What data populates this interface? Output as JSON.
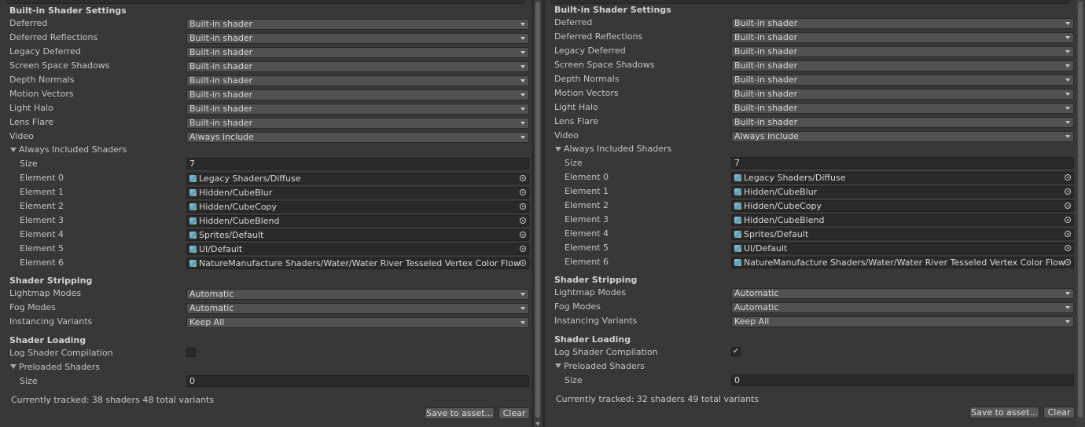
{
  "left": {
    "builtin_header": "Built-in Shader Settings",
    "builtin": [
      {
        "label": "Deferred",
        "value": "Built-in shader"
      },
      {
        "label": "Deferred Reflections",
        "value": "Built-in shader"
      },
      {
        "label": "Legacy Deferred",
        "value": "Built-in shader"
      },
      {
        "label": "Screen Space Shadows",
        "value": "Built-in shader"
      },
      {
        "label": "Depth Normals",
        "value": "Built-in shader"
      },
      {
        "label": "Motion Vectors",
        "value": "Built-in shader"
      },
      {
        "label": "Light Halo",
        "value": "Built-in shader"
      },
      {
        "label": "Lens Flare",
        "value": "Built-in shader"
      },
      {
        "label": "Video",
        "value": "Always include"
      }
    ],
    "always_label": "Always Included Shaders",
    "size_label": "Size",
    "size_value": "7",
    "elements": [
      {
        "label": "Element 0",
        "value": "Legacy Shaders/Diffuse"
      },
      {
        "label": "Element 1",
        "value": "Hidden/CubeBlur"
      },
      {
        "label": "Element 2",
        "value": "Hidden/CubeCopy"
      },
      {
        "label": "Element 3",
        "value": "Hidden/CubeBlend"
      },
      {
        "label": "Element 4",
        "value": "Sprites/Default"
      },
      {
        "label": "Element 5",
        "value": "UI/Default"
      },
      {
        "label": "Element 6",
        "value": "NatureManufacture Shaders/Water/Water River Tesseled Vertex Color Flow"
      }
    ],
    "stripping_header": "Shader Stripping",
    "stripping": [
      {
        "label": "Lightmap Modes",
        "value": "Automatic"
      },
      {
        "label": "Fog Modes",
        "value": "Automatic"
      },
      {
        "label": "Instancing Variants",
        "value": "Keep All"
      }
    ],
    "loading_header": "Shader Loading",
    "log_label": "Log Shader Compilation",
    "log_checked": "",
    "preloaded_label": "Preloaded Shaders",
    "preloaded_size_label": "Size",
    "preloaded_size_value": "0",
    "status": "Currently tracked: 38 shaders 48 total variants",
    "save_btn": "Save to asset...",
    "clear_btn": "Clear"
  },
  "right": {
    "builtin_header": "Built-in Shader Settings",
    "builtin": [
      {
        "label": "Deferred",
        "value": "Built-in shader"
      },
      {
        "label": "Deferred Reflections",
        "value": "Built-in shader"
      },
      {
        "label": "Legacy Deferred",
        "value": "Built-in shader"
      },
      {
        "label": "Screen Space Shadows",
        "value": "Built-in shader"
      },
      {
        "label": "Depth Normals",
        "value": "Built-in shader"
      },
      {
        "label": "Motion Vectors",
        "value": "Built-in shader"
      },
      {
        "label": "Light Halo",
        "value": "Built-in shader"
      },
      {
        "label": "Lens Flare",
        "value": "Built-in shader"
      },
      {
        "label": "Video",
        "value": "Always include"
      }
    ],
    "always_label": "Always Included Shaders",
    "size_label": "Size",
    "size_value": "7",
    "elements": [
      {
        "label": "Element 0",
        "value": "Legacy Shaders/Diffuse"
      },
      {
        "label": "Element 1",
        "value": "Hidden/CubeBlur"
      },
      {
        "label": "Element 2",
        "value": "Hidden/CubeCopy"
      },
      {
        "label": "Element 3",
        "value": "Hidden/CubeBlend"
      },
      {
        "label": "Element 4",
        "value": "Sprites/Default"
      },
      {
        "label": "Element 5",
        "value": "UI/Default"
      },
      {
        "label": "Element 6",
        "value": "NatureManufacture Shaders/Water/Water River Tesseled Vertex Color Flow"
      }
    ],
    "stripping_header": "Shader Stripping",
    "stripping": [
      {
        "label": "Lightmap Modes",
        "value": "Automatic"
      },
      {
        "label": "Fog Modes",
        "value": "Automatic"
      },
      {
        "label": "Instancing Variants",
        "value": "Keep All"
      }
    ],
    "loading_header": "Shader Loading",
    "log_label": "Log Shader Compilation",
    "log_checked": "✓",
    "preloaded_label": "Preloaded Shaders",
    "preloaded_size_label": "Size",
    "preloaded_size_value": "0",
    "status": "Currently tracked: 32 shaders 49 total variants",
    "save_btn": "Save to asset...",
    "clear_btn": "Clear"
  }
}
